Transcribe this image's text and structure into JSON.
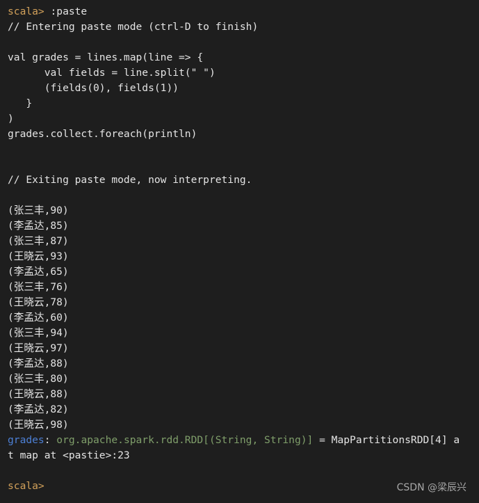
{
  "terminal": {
    "app": "scala-repl",
    "colors": {
      "background": "#1e1e1e",
      "foreground": "#e4e4e4",
      "prompt": "#d1a05a",
      "identifier": "#4d80d6",
      "type": "#7f9e6a"
    },
    "lines": [
      {
        "id": "l01",
        "segments": [
          {
            "name": "prompt",
            "text": "scala>",
            "style": "tok-prompt"
          },
          {
            "name": "command",
            "text": " :paste",
            "style": "tok-plain"
          }
        ]
      },
      {
        "id": "l02",
        "segments": [
          {
            "name": "comment",
            "text": "// Entering paste mode (ctrl-D to finish)",
            "style": "tok-plain"
          }
        ]
      },
      {
        "id": "l03",
        "segments": []
      },
      {
        "id": "l04",
        "segments": [
          {
            "name": "code",
            "text": "val grades = lines.map(line => {",
            "style": "tok-plain"
          }
        ]
      },
      {
        "id": "l05",
        "segments": [
          {
            "name": "code",
            "text": "      val fields = line.split(\" \")",
            "style": "tok-plain"
          }
        ]
      },
      {
        "id": "l06",
        "segments": [
          {
            "name": "code",
            "text": "      (fields(0), fields(1))",
            "style": "tok-plain"
          }
        ]
      },
      {
        "id": "l07",
        "segments": [
          {
            "name": "code",
            "text": "   }",
            "style": "tok-plain"
          }
        ]
      },
      {
        "id": "l08",
        "segments": [
          {
            "name": "code",
            "text": ")",
            "style": "tok-plain"
          }
        ]
      },
      {
        "id": "l09",
        "segments": [
          {
            "name": "code",
            "text": "grades.collect.foreach(println)",
            "style": "tok-plain"
          }
        ]
      },
      {
        "id": "l10",
        "segments": []
      },
      {
        "id": "l11",
        "segments": []
      },
      {
        "id": "l12",
        "segments": [
          {
            "name": "comment",
            "text": "// Exiting paste mode, now interpreting.",
            "style": "tok-plain"
          }
        ]
      },
      {
        "id": "l13",
        "segments": []
      },
      {
        "id": "l14",
        "segments": [
          {
            "name": "output",
            "text": "(张三丰,90)",
            "style": "tok-plain"
          }
        ]
      },
      {
        "id": "l15",
        "segments": [
          {
            "name": "output",
            "text": "(李孟达,85)",
            "style": "tok-plain"
          }
        ]
      },
      {
        "id": "l16",
        "segments": [
          {
            "name": "output",
            "text": "(张三丰,87)",
            "style": "tok-plain"
          }
        ]
      },
      {
        "id": "l17",
        "segments": [
          {
            "name": "output",
            "text": "(王晓云,93)",
            "style": "tok-plain"
          }
        ]
      },
      {
        "id": "l18",
        "segments": [
          {
            "name": "output",
            "text": "(李孟达,65)",
            "style": "tok-plain"
          }
        ]
      },
      {
        "id": "l19",
        "segments": [
          {
            "name": "output",
            "text": "(张三丰,76)",
            "style": "tok-plain"
          }
        ]
      },
      {
        "id": "l20",
        "segments": [
          {
            "name": "output",
            "text": "(王晓云,78)",
            "style": "tok-plain"
          }
        ]
      },
      {
        "id": "l21",
        "segments": [
          {
            "name": "output",
            "text": "(李孟达,60)",
            "style": "tok-plain"
          }
        ]
      },
      {
        "id": "l22",
        "segments": [
          {
            "name": "output",
            "text": "(张三丰,94)",
            "style": "tok-plain"
          }
        ]
      },
      {
        "id": "l23",
        "segments": [
          {
            "name": "output",
            "text": "(王晓云,97)",
            "style": "tok-plain"
          }
        ]
      },
      {
        "id": "l24",
        "segments": [
          {
            "name": "output",
            "text": "(李孟达,88)",
            "style": "tok-plain"
          }
        ]
      },
      {
        "id": "l25",
        "segments": [
          {
            "name": "output",
            "text": "(张三丰,80)",
            "style": "tok-plain"
          }
        ]
      },
      {
        "id": "l26",
        "segments": [
          {
            "name": "output",
            "text": "(王晓云,88)",
            "style": "tok-plain"
          }
        ]
      },
      {
        "id": "l27",
        "segments": [
          {
            "name": "output",
            "text": "(李孟达,82)",
            "style": "tok-plain"
          }
        ]
      },
      {
        "id": "l28",
        "segments": [
          {
            "name": "output",
            "text": "(王晓云,98)",
            "style": "tok-plain"
          }
        ]
      },
      {
        "id": "l29",
        "segments": [
          {
            "name": "result-name",
            "text": "grades",
            "style": "tok-ident"
          },
          {
            "name": "result-colon",
            "text": ": ",
            "style": "tok-plain"
          },
          {
            "name": "result-type",
            "text": "org.apache.spark.rdd.RDD[(String, String)]",
            "style": "tok-type"
          },
          {
            "name": "result-value",
            "text": " = MapPartitionsRDD[4] a",
            "style": "tok-plain"
          }
        ]
      },
      {
        "id": "l30",
        "segments": [
          {
            "name": "result-value-wrap",
            "text": "t map at <pastie>:23",
            "style": "tok-plain"
          }
        ]
      },
      {
        "id": "l31",
        "segments": []
      },
      {
        "id": "l32",
        "segments": [
          {
            "name": "prompt",
            "text": "scala>",
            "style": "tok-prompt"
          }
        ]
      }
    ]
  },
  "watermark": {
    "text": "CSDN @梁辰兴"
  }
}
